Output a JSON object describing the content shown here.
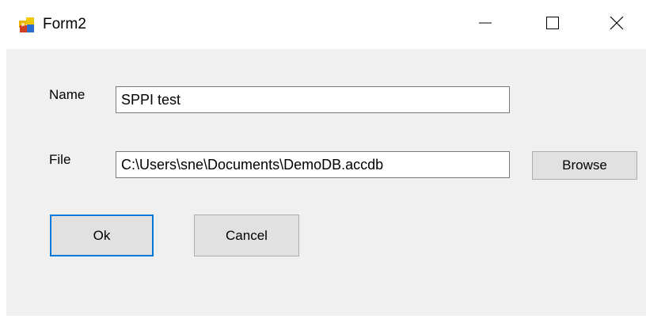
{
  "window": {
    "title": "Form2",
    "icon": "form-app-icon",
    "controls": {
      "minimize": "minimize-icon",
      "maximize": "maximize-icon",
      "close": "close-icon"
    }
  },
  "form": {
    "name_label": "Name",
    "name_value": "SPPI test",
    "file_label": "File",
    "file_value": "C:\\Users\\sne\\Documents\\DemoDB.accdb",
    "browse_label": "Browse",
    "ok_label": "Ok",
    "cancel_label": "Cancel"
  },
  "colors": {
    "client_background": "#f0f0f0",
    "button_background": "#e1e1e1",
    "focus_border": "#0078d7"
  }
}
